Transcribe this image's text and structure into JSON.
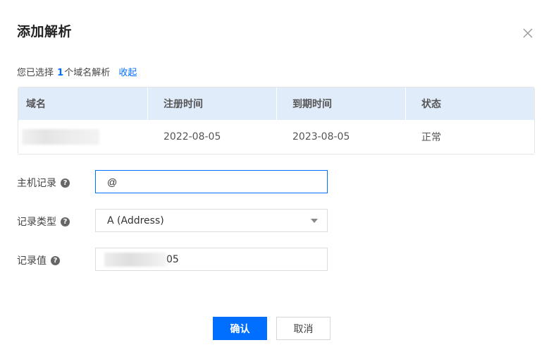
{
  "dialog": {
    "title": "添加解析"
  },
  "summary": {
    "prefix": "您已选择 ",
    "count": "1",
    "suffix": "个域名解析",
    "collapse_label": "收起"
  },
  "table": {
    "headers": [
      "域名",
      "注册时间",
      "到期时间",
      "状态"
    ],
    "rows": [
      {
        "domain": "",
        "registered": "2022-08-05",
        "expires": "2023-08-05",
        "status": "正常"
      }
    ]
  },
  "form": {
    "host_record": {
      "label": "主机记录",
      "value": "@"
    },
    "record_type": {
      "label": "记录类型",
      "value": "A (Address)"
    },
    "record_value": {
      "label": "记录值",
      "value_suffix": "05"
    }
  },
  "buttons": {
    "confirm": "确认",
    "cancel": "取消"
  },
  "colors": {
    "accent": "#006eff",
    "status_ok": "#29a35a",
    "header_bg": "#e1ecfb"
  }
}
